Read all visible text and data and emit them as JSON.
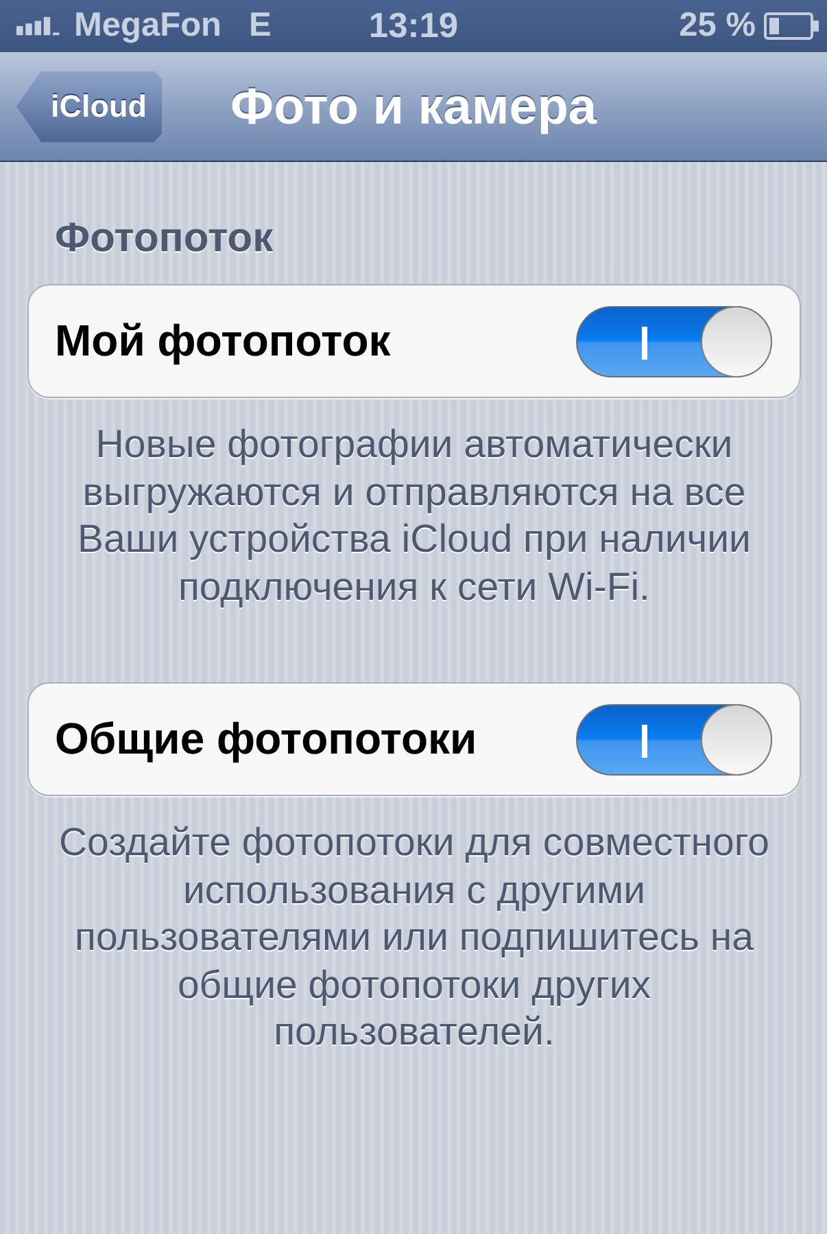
{
  "status_bar": {
    "carrier": "MegaFon",
    "network": "E",
    "time": "13:19",
    "battery": "25 %"
  },
  "nav_bar": {
    "back_button": "iCloud",
    "title": "Фото и камера"
  },
  "groups": [
    {
      "header": "Фотопоток",
      "cells": [
        {
          "label": "Мой фотопоток",
          "on": true
        }
      ],
      "footer": "Новые фотографии автоматически выгружаются и отправляются на все Ваши устройства iCloud при наличии подключения к сети Wi-Fi."
    },
    {
      "cells": [
        {
          "label": "Общие фотопотоки",
          "on": true
        }
      ],
      "footer": "Создайте фотопотоки для совместного использования с другими пользователями или подпишитесь на общие фотопотоки других пользователей."
    }
  ]
}
